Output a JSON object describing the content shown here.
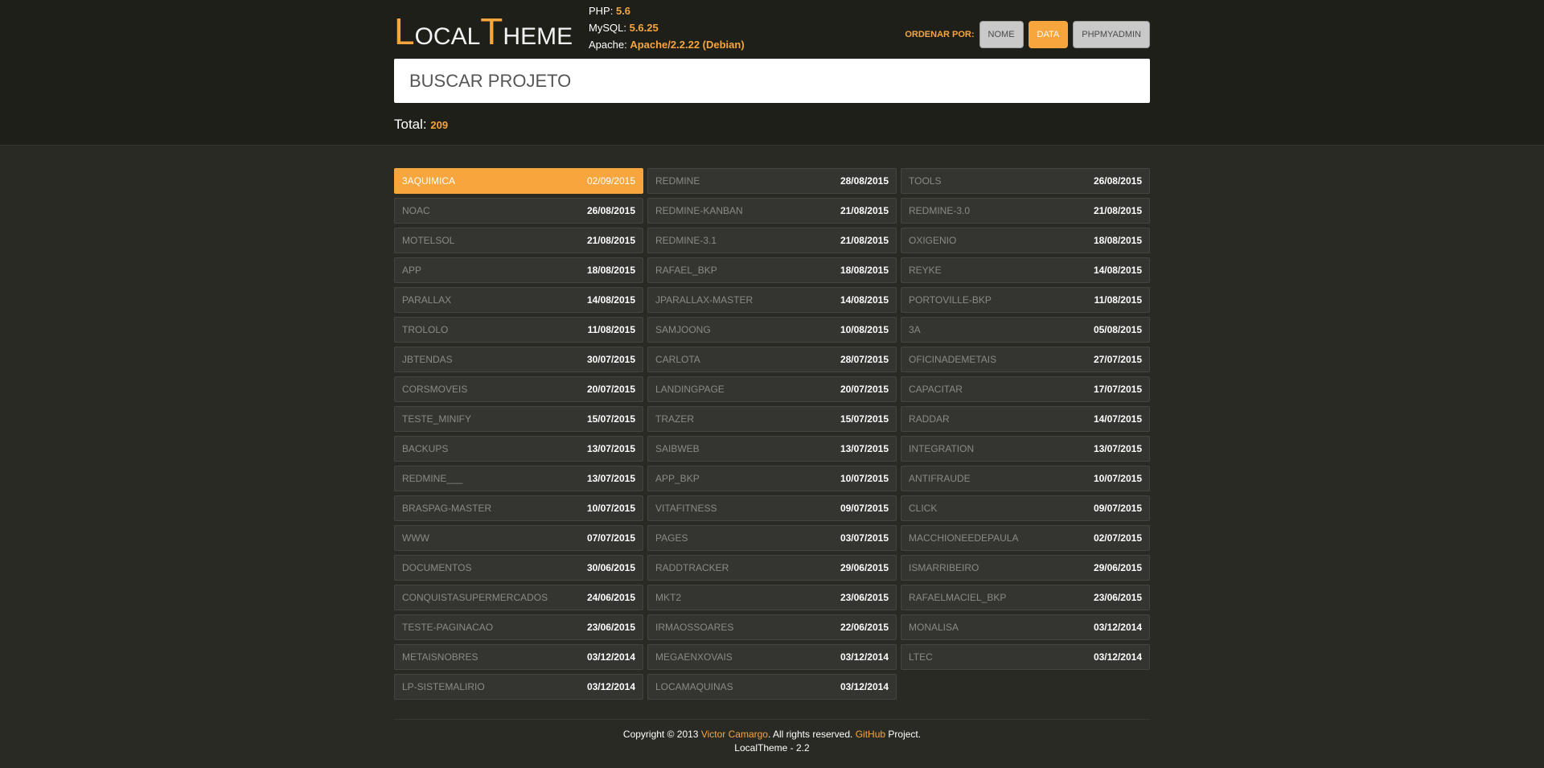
{
  "logo": {
    "l_big": "L",
    "l_rest": "OCAL",
    "t_big": "T",
    "t_rest": "HEME"
  },
  "server": {
    "php_label": "PHP:",
    "php_value": "5.6",
    "mysql_label": "MySQL:",
    "mysql_value": "5.6.25",
    "apache_label": "Apache:",
    "apache_value": "Apache/2.2.22 (Debian)"
  },
  "sort": {
    "label": "ORDENAR POR:",
    "buttons": [
      {
        "label": "NOME",
        "active": false
      },
      {
        "label": "DATA",
        "active": true
      },
      {
        "label": "PHPMYADMIN",
        "active": false
      }
    ]
  },
  "search": {
    "placeholder": "BUSCAR PROJETO"
  },
  "total": {
    "label": "Total:",
    "value": "209"
  },
  "projects": [
    {
      "name": "3AQUIMICA",
      "date": "02/09/2015",
      "active": true
    },
    {
      "name": "REDMINE",
      "date": "28/08/2015"
    },
    {
      "name": "TOOLS",
      "date": "26/08/2015"
    },
    {
      "name": "NOAC",
      "date": "26/08/2015"
    },
    {
      "name": "REDMINE-KANBAN",
      "date": "21/08/2015"
    },
    {
      "name": "REDMINE-3.0",
      "date": "21/08/2015"
    },
    {
      "name": "MOTELSOL",
      "date": "21/08/2015"
    },
    {
      "name": "REDMINE-3.1",
      "date": "21/08/2015"
    },
    {
      "name": "OXIGENIO",
      "date": "18/08/2015"
    },
    {
      "name": "APP",
      "date": "18/08/2015"
    },
    {
      "name": "RAFAEL_BKP",
      "date": "18/08/2015"
    },
    {
      "name": "REYKE",
      "date": "14/08/2015"
    },
    {
      "name": "PARALLAX",
      "date": "14/08/2015"
    },
    {
      "name": "JPARALLAX-MASTER",
      "date": "14/08/2015"
    },
    {
      "name": "PORTOVILLE-BKP",
      "date": "11/08/2015"
    },
    {
      "name": "TROLOLO",
      "date": "11/08/2015"
    },
    {
      "name": "SAMJOONG",
      "date": "10/08/2015"
    },
    {
      "name": "3A",
      "date": "05/08/2015"
    },
    {
      "name": "JBTENDAS",
      "date": "30/07/2015"
    },
    {
      "name": "CARLOTA",
      "date": "28/07/2015"
    },
    {
      "name": "OFICINADEMETAIS",
      "date": "27/07/2015"
    },
    {
      "name": "CORSMOVEIS",
      "date": "20/07/2015"
    },
    {
      "name": "LANDINGPAGE",
      "date": "20/07/2015"
    },
    {
      "name": "CAPACITAR",
      "date": "17/07/2015"
    },
    {
      "name": "TESTE_MINIFY",
      "date": "15/07/2015"
    },
    {
      "name": "TRAZER",
      "date": "15/07/2015"
    },
    {
      "name": "RADDAR",
      "date": "14/07/2015"
    },
    {
      "name": "BACKUPS",
      "date": "13/07/2015"
    },
    {
      "name": "SAIBWEB",
      "date": "13/07/2015"
    },
    {
      "name": "INTEGRATION",
      "date": "13/07/2015"
    },
    {
      "name": "REDMINE___",
      "date": "13/07/2015"
    },
    {
      "name": "APP_BKP",
      "date": "10/07/2015"
    },
    {
      "name": "ANTIFRAUDE",
      "date": "10/07/2015"
    },
    {
      "name": "BRASPAG-MASTER",
      "date": "10/07/2015"
    },
    {
      "name": "VITAFITNESS",
      "date": "09/07/2015"
    },
    {
      "name": "CLICK",
      "date": "09/07/2015"
    },
    {
      "name": "WWW",
      "date": "07/07/2015"
    },
    {
      "name": "PAGES",
      "date": "03/07/2015"
    },
    {
      "name": "MACCHIONEEDEPAULA",
      "date": "02/07/2015"
    },
    {
      "name": "DOCUMENTOS",
      "date": "30/06/2015"
    },
    {
      "name": "RADDTRACKER",
      "date": "29/06/2015"
    },
    {
      "name": "ISMARRIBEIRO",
      "date": "29/06/2015"
    },
    {
      "name": "CONQUISTASUPERMERCADOS",
      "date": "24/06/2015"
    },
    {
      "name": "MKT2",
      "date": "23/06/2015"
    },
    {
      "name": "RAFAELMACIEL_BKP",
      "date": "23/06/2015"
    },
    {
      "name": "TESTE-PAGINACAO",
      "date": "23/06/2015"
    },
    {
      "name": "IRMAOSSOARES",
      "date": "22/06/2015"
    },
    {
      "name": "MONALISA",
      "date": "03/12/2014"
    },
    {
      "name": "METAISNOBRES",
      "date": "03/12/2014"
    },
    {
      "name": "MEGAENXOVAIS",
      "date": "03/12/2014"
    },
    {
      "name": "LTEC",
      "date": "03/12/2014"
    },
    {
      "name": "LP-SISTEMALIRIO",
      "date": "03/12/2014"
    },
    {
      "name": "LOCAMAQUINAS",
      "date": "03/12/2014"
    }
  ],
  "footer": {
    "copyright": "Copyright © 2013",
    "author": "Victor Camargo",
    "rights": ". All rights reserved.",
    "github": "GitHub",
    "project": "Project.",
    "version": "LocalTheme - 2.2"
  },
  "colors": {
    "accent": "#f7a53d",
    "background": "#2a2a25",
    "header": "#1f1f1a"
  }
}
